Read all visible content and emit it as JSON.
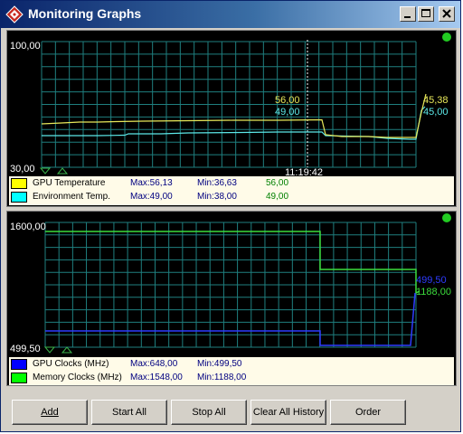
{
  "window": {
    "title": "Monitoring Graphs"
  },
  "colors": {
    "grid": "#1f7f7f",
    "gpu_temp": "#e8e85a",
    "env_temp": "#5ce8e8",
    "gpu_clock": "#2e3cff",
    "mem_clock": "#3cdc3c",
    "status_led": "#22cc22"
  },
  "graph1": {
    "y_max_label": "100,00",
    "y_min_label": "30,00",
    "cursor_time": "11:19:42",
    "cursor_val_1": "56,00",
    "cursor_val_2": "49,00",
    "right_val_1": "45,38",
    "right_val_2": "45,00",
    "legend": [
      {
        "name": "GPU Temperature",
        "max": "Max:56,13",
        "min": "Min:36,63",
        "current": "56,00",
        "color": "#ffff00"
      },
      {
        "name": "Environment Temp.",
        "max": "Max:49,00",
        "min": "Min:38,00",
        "current": "49,00",
        "color": "#00ffff"
      }
    ]
  },
  "graph2": {
    "y_max_label": "1600,00",
    "y_min_label": "499,50",
    "right_val_1": "499,50",
    "right_val_2": "1188,00",
    "legend": [
      {
        "name": "GPU Clocks (MHz)",
        "max": "Max:648,00",
        "min": "Min:499,50",
        "color": "#0000ff"
      },
      {
        "name": "Memory Clocks (MHz)",
        "max": "Max:1548,00",
        "min": "Min:1188,00",
        "color": "#00ff00"
      }
    ]
  },
  "buttons": {
    "add": "Add",
    "start_all": "Start All",
    "stop_all": "Stop All",
    "clear_history": "Clear All History",
    "order": "Order"
  },
  "icons": {
    "app": "app-diamond-icon",
    "minimize": "minimize-icon",
    "maximize": "maximize-icon",
    "close": "close-icon",
    "status": "status-led-icon",
    "scroll": "scroll-arrow-icon"
  }
}
